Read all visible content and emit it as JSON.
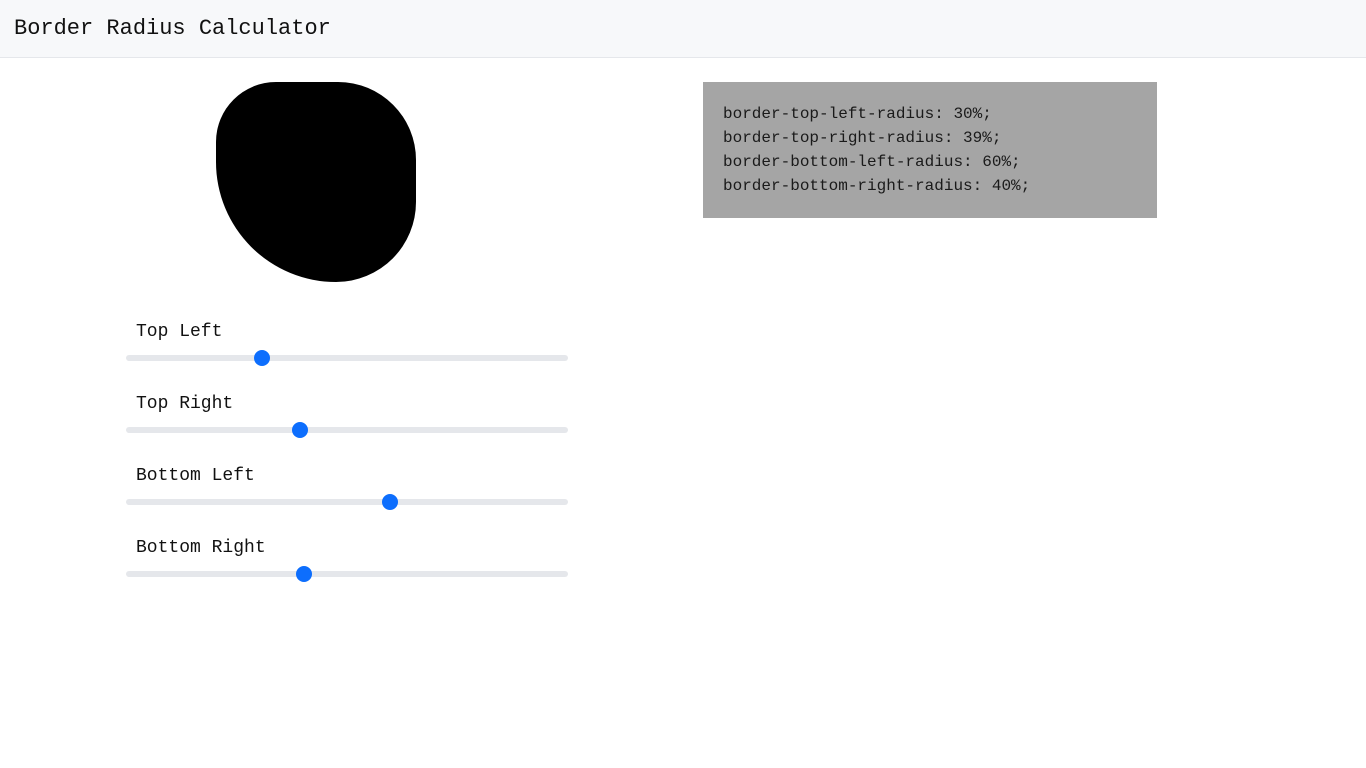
{
  "header": {
    "title": "Border Radius Calculator"
  },
  "sliders": {
    "topLeft": {
      "label": "Top Left",
      "value": 30
    },
    "topRight": {
      "label": "Top Right",
      "value": 39
    },
    "bottomLeft": {
      "label": "Bottom Left",
      "value": 60
    },
    "bottomRight": {
      "label": "Bottom Right",
      "value": 40
    }
  },
  "code": {
    "line1": "border-top-left-radius: 30%;",
    "line2": "border-top-right-radius: 39%;",
    "line3": "border-bottom-left-radius: 60%;",
    "line4": "border-bottom-right-radius: 40%;"
  }
}
